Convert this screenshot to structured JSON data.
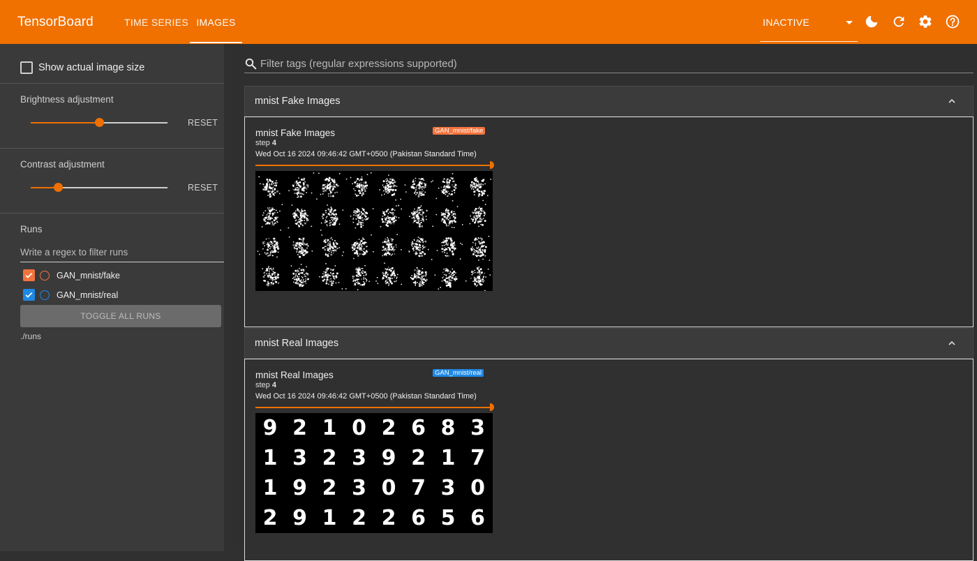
{
  "header": {
    "brand": "TensorBoard",
    "tabs": [
      "TIME SERIES",
      "IMAGES"
    ],
    "active_tab": "IMAGES",
    "status_select": "INACTIVE",
    "icons": [
      "dark-mode-icon",
      "reload-icon",
      "settings-icon",
      "help-icon"
    ],
    "accent_color": "#f07000"
  },
  "sidebar": {
    "show_actual_size_label": "Show actual image size",
    "show_actual_size_checked": false,
    "brightness": {
      "label": "Brightness adjustment",
      "level": 0.5,
      "reset_label": "RESET"
    },
    "contrast": {
      "label": "Contrast adjustment",
      "level": 0.2,
      "reset_label": "RESET"
    },
    "runs": {
      "title": "Runs",
      "filter_placeholder": "Write a regex to filter runs",
      "items": [
        {
          "label": "GAN_mnist/fake",
          "checked": true,
          "color": "#f4733c"
        },
        {
          "label": "GAN_mnist/real",
          "checked": true,
          "color": "#1e88e5"
        }
      ],
      "toggle_label": "TOGGLE ALL RUNS",
      "directory": "./runs"
    }
  },
  "main": {
    "filter_placeholder": "Filter tags (regular expressions supported)",
    "groups": [
      {
        "title": "mnist Fake Images",
        "card": {
          "title": "mnist Fake Images",
          "step_label": "step",
          "step": "4",
          "timestamp": "Wed Oct 16 2024 09:46:42 GMT+0500 (Pakistan Standard Time)",
          "run_tag": "GAN_mnist/fake",
          "tag_color": "#f4733c"
        }
      },
      {
        "title": "mnist Real Images",
        "card": {
          "title": "mnist Real Images",
          "step_label": "step",
          "step": "4",
          "timestamp": "Wed Oct 16 2024 09:46:42 GMT+0500 (Pakistan Standard Time)",
          "run_tag": "GAN_mnist/real",
          "tag_color": "#1e88e5",
          "digits": [
            [
              "9",
              "2",
              "1",
              "0",
              "2",
              "6",
              "8",
              "3"
            ],
            [
              "1",
              "3",
              "2",
              "3",
              "9",
              "2",
              "1",
              "7"
            ],
            [
              "1",
              "9",
              "2",
              "3",
              "0",
              "7",
              "3",
              "0"
            ],
            [
              "2",
              "9",
              "1",
              "2",
              "2",
              "6",
              "5",
              "6"
            ]
          ]
        }
      }
    ]
  }
}
